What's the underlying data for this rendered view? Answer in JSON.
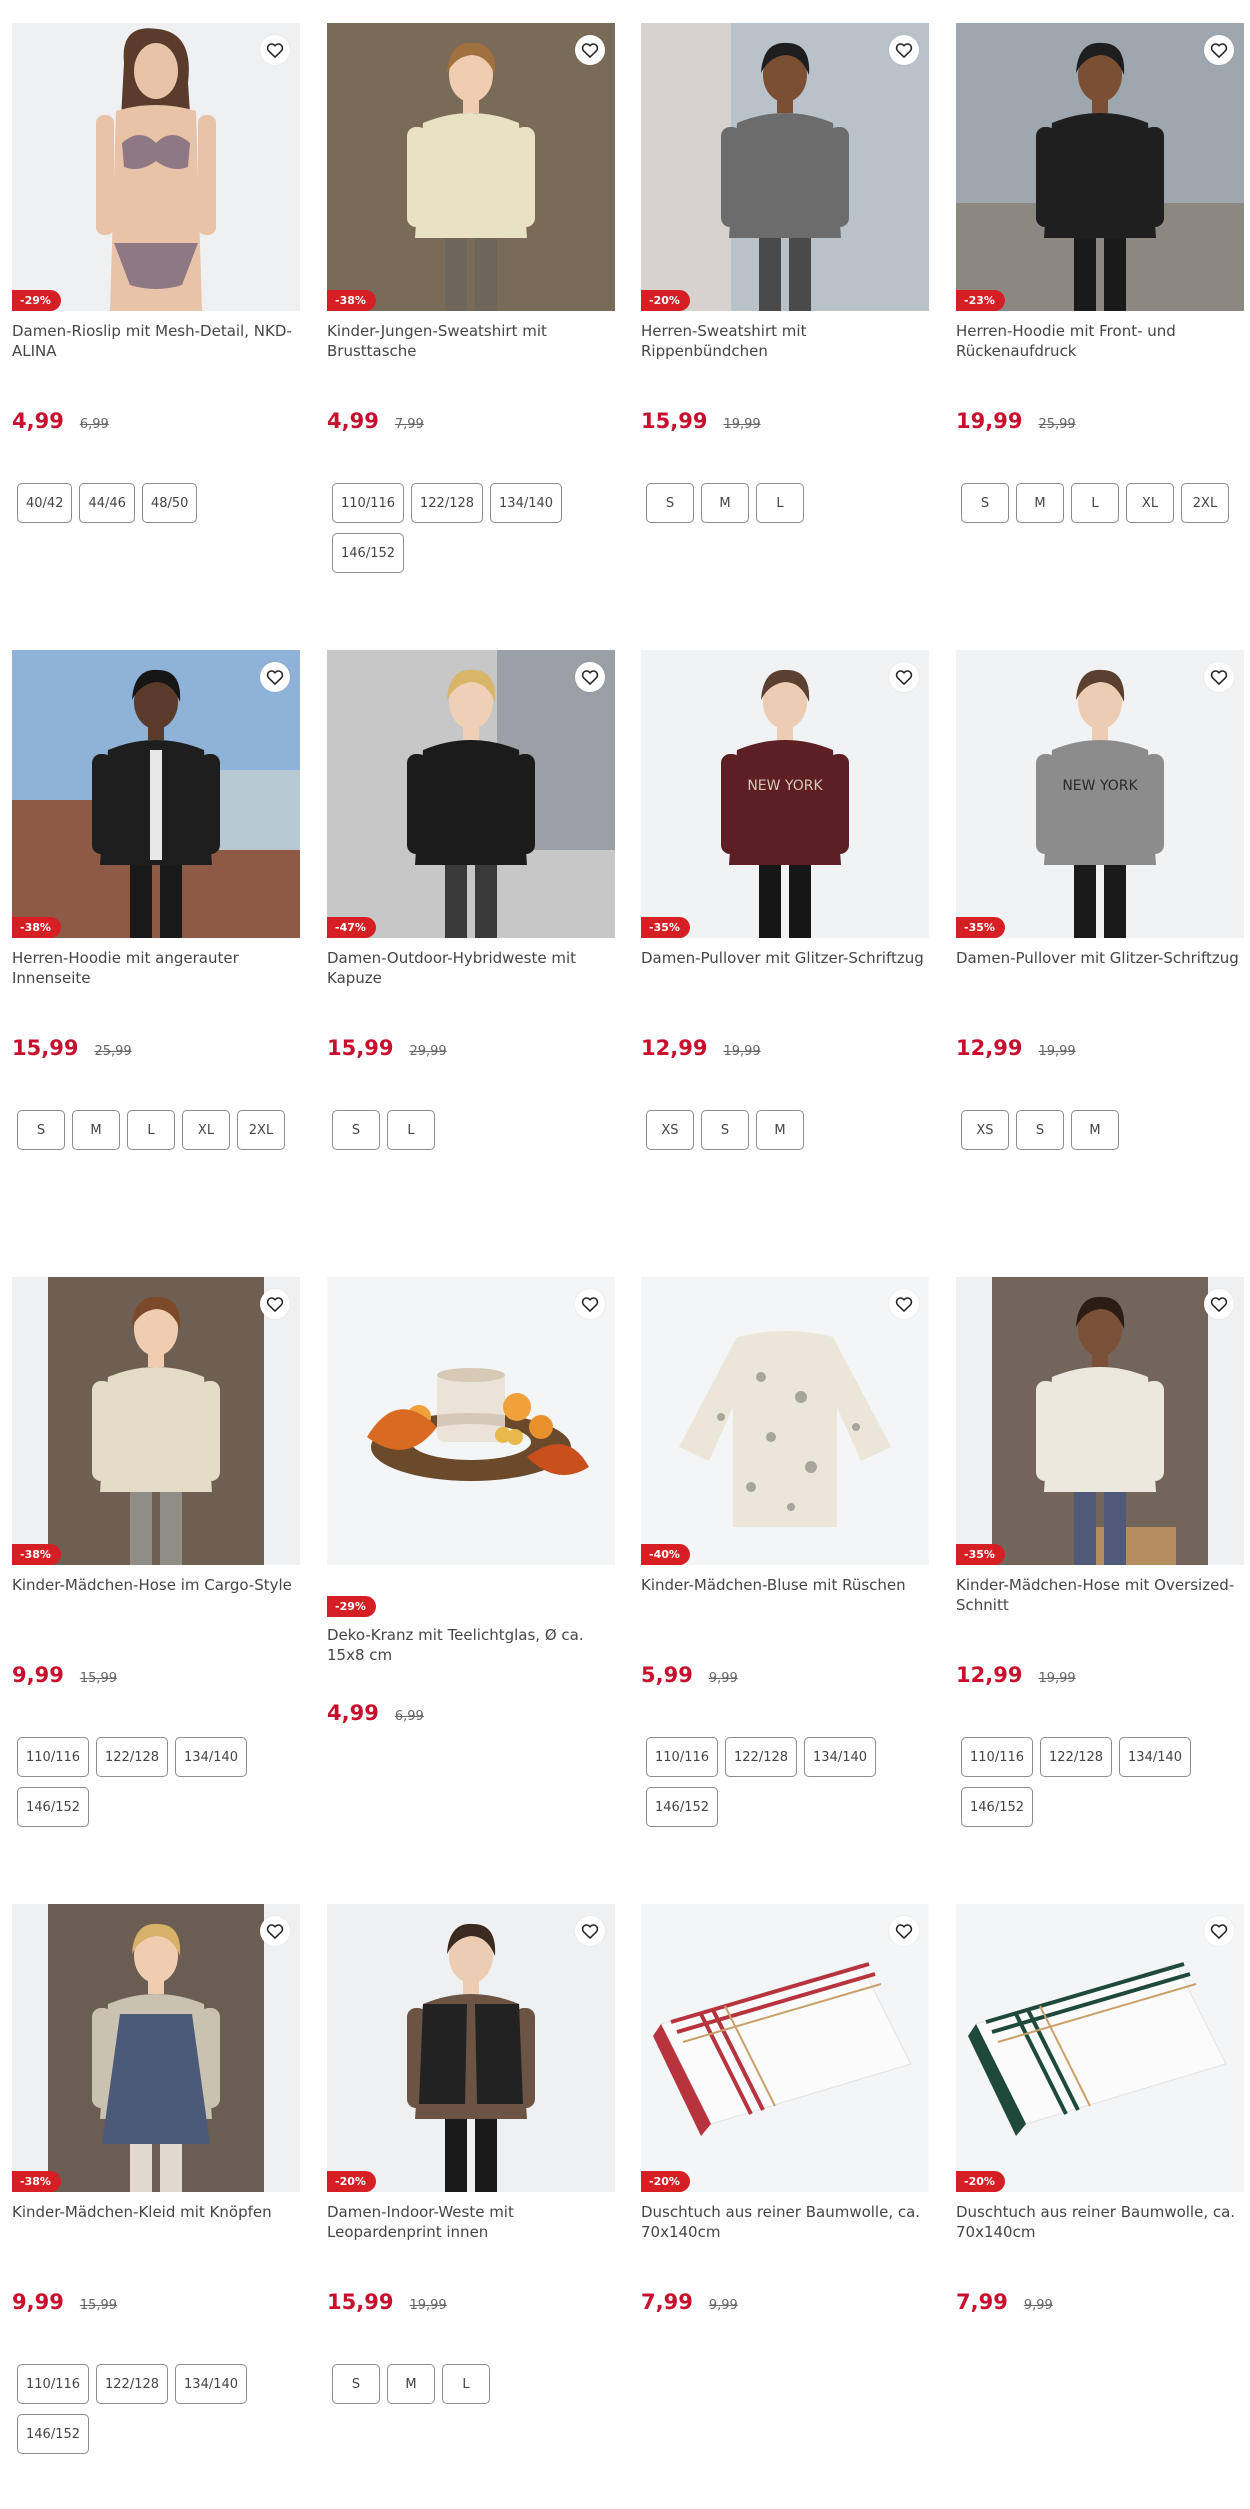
{
  "colors": {
    "sale_red": "#c8102e",
    "badge_red": "#d51f25",
    "border": "#8c8c8c"
  },
  "icons": {
    "favorite": "heart-outline-icon"
  },
  "products": [
    {
      "title": "Damen-Rioslip mit Mesh-Detail, NKD-ALINA",
      "badge": "-29%",
      "price": "4,99",
      "old_price": "6,99",
      "sizes": [
        "40/42",
        "44/46",
        "48/50"
      ]
    },
    {
      "title": "Kinder-Jungen-Sweatshirt mit Brusttasche",
      "badge": "-38%",
      "price": "4,99",
      "old_price": "7,99",
      "sizes": [
        "110/116",
        "122/128",
        "134/140",
        "146/152"
      ]
    },
    {
      "title": "Herren-Sweatshirt mit Rippenbündchen",
      "badge": "-20%",
      "price": "15,99",
      "old_price": "19,99",
      "sizes": [
        "S",
        "M",
        "L"
      ]
    },
    {
      "title": "Herren-Hoodie mit Front- und Rückenaufdruck",
      "badge": "-23%",
      "price": "19,99",
      "old_price": "25,99",
      "sizes": [
        "S",
        "M",
        "L",
        "XL",
        "2XL"
      ]
    },
    {
      "title": "Herren-Hoodie mit angerauter Innenseite",
      "badge": "-38%",
      "price": "15,99",
      "old_price": "25,99",
      "sizes": [
        "S",
        "M",
        "L",
        "XL",
        "2XL"
      ]
    },
    {
      "title": "Damen-Outdoor-Hybridweste mit Kapuze",
      "badge": "-47%",
      "price": "15,99",
      "old_price": "29,99",
      "sizes": [
        "S",
        "L"
      ]
    },
    {
      "title": "Damen-Pullover mit Glitzer-Schriftzug",
      "badge": "-35%",
      "price": "12,99",
      "old_price": "19,99",
      "sizes": [
        "XS",
        "S",
        "M"
      ]
    },
    {
      "title": "Damen-Pullover mit Glitzer-Schriftzug",
      "badge": "-35%",
      "price": "12,99",
      "old_price": "19,99",
      "sizes": [
        "XS",
        "S",
        "M"
      ]
    },
    {
      "title": "Kinder-Mädchen-Hose im Cargo-Style",
      "badge": "-38%",
      "price": "9,99",
      "old_price": "15,99",
      "sizes": [
        "110/116",
        "122/128",
        "134/140",
        "146/152"
      ]
    },
    {
      "title": "Deko-Kranz mit Teelichtglas, Ø ca. 15x8 cm",
      "badge": "-29%",
      "price": "4,99",
      "old_price": "6,99",
      "sizes": []
    },
    {
      "title": "Kinder-Mädchen-Bluse mit Rüschen",
      "badge": "-40%",
      "price": "5,99",
      "old_price": "9,99",
      "sizes": [
        "110/116",
        "122/128",
        "134/140",
        "146/152"
      ]
    },
    {
      "title": "Kinder-Mädchen-Hose mit Oversized-Schnitt",
      "badge": "-35%",
      "price": "12,99",
      "old_price": "19,99",
      "sizes": [
        "110/116",
        "122/128",
        "134/140",
        "146/152"
      ]
    },
    {
      "title": "Kinder-Mädchen-Kleid mit Knöpfen",
      "badge": "-38%",
      "price": "9,99",
      "old_price": "15,99",
      "sizes": [
        "110/116",
        "122/128",
        "134/140",
        "146/152"
      ]
    },
    {
      "title": "Damen-Indoor-Weste mit Leopardenprint innen",
      "badge": "-20%",
      "price": "15,99",
      "old_price": "19,99",
      "sizes": [
        "S",
        "M",
        "L"
      ]
    },
    {
      "title": "Duschtuch aus reiner Baumwolle, ca. 70x140cm",
      "badge": "-20%",
      "price": "7,99",
      "old_price": "9,99",
      "sizes": []
    },
    {
      "title": "Duschtuch aus reiner Baumwolle, ca. 70x140cm",
      "badge": "-20%",
      "price": "7,99",
      "old_price": "9,99",
      "sizes": []
    }
  ]
}
